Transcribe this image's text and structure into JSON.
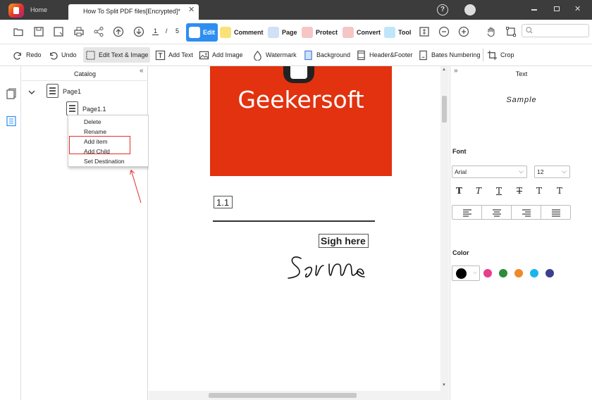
{
  "window": {
    "home_tab": "Home",
    "doc_tab": "How To Split PDF files[Encrypted]*",
    "close_tab": "✕"
  },
  "toolbar": {
    "current_page": "1",
    "page_separator": "/",
    "total_pages": "5",
    "modes": [
      {
        "label": "Edit",
        "active": true,
        "color": "#2d8ef0"
      },
      {
        "label": "Comment",
        "color": "#f5c518"
      },
      {
        "label": "Page",
        "color": "#3a7bd5"
      },
      {
        "label": "Protect",
        "color": "#d33"
      },
      {
        "label": "Convert",
        "color": "#d33"
      },
      {
        "label": "Tool",
        "color": "#2aa3e0"
      }
    ]
  },
  "edit_toolbar": {
    "redo": "Redo",
    "undo": "Undo",
    "edit_text_image": "Edit Text & Image",
    "add_text": "Add Text",
    "add_image": "Add Image",
    "watermark": "Watermark",
    "background": "Background",
    "header_footer": "Header&Footer",
    "bates": "Bates Numbering",
    "crop": "Crop"
  },
  "catalog": {
    "title": "Catalog",
    "collapse": "«",
    "items": [
      {
        "label": "Page1"
      },
      {
        "label": "Page1.1"
      }
    ],
    "context_menu": [
      "Delete",
      "Rename",
      "Add item",
      "Add Child",
      "Set Destination"
    ]
  },
  "document": {
    "banner_text": "Geekersoft",
    "number_label": "1.1",
    "sign_label": "Sigh here",
    "banner_color": "#e2320f"
  },
  "text_panel": {
    "title": "Text",
    "expand": "»",
    "sample": "Sample",
    "font_label": "Font",
    "font_family": "Arial",
    "font_size": "12",
    "style_labels": [
      "T",
      "T",
      "T",
      "T",
      "T",
      "T"
    ],
    "color_label": "Color",
    "colors": [
      "#000000",
      "#e83e8c",
      "#2e8b3a",
      "#ee8a2a",
      "#1ab6ea",
      "#3b3f8f"
    ]
  }
}
